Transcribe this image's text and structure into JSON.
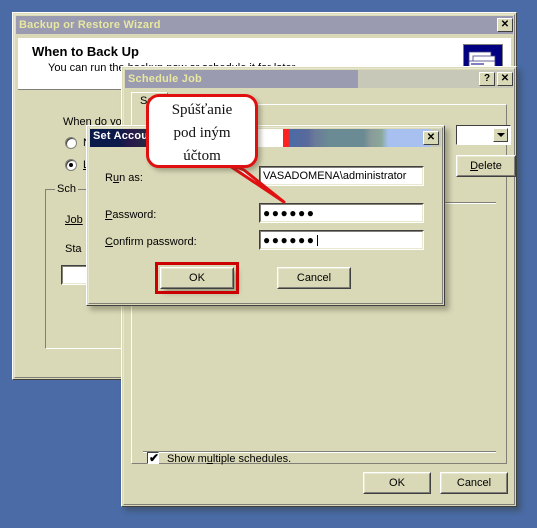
{
  "desktop": {
    "background_color": "#4a6ba5"
  },
  "wizard": {
    "title": "Backup or Restore Wizard",
    "close_label": "✕",
    "heading": "When to Back Up",
    "subheading": "You can run the backup now or schedule it for later.",
    "icon_name": "backup-wizard-icon",
    "prompt": "When do you",
    "radio_now_label": "N",
    "radio_later_label": "La",
    "group_label": "Sch",
    "field_job_label": "Job",
    "field_start_label": "Sta"
  },
  "schedule_job": {
    "title": "Schedule Job",
    "help_label": "?",
    "close_label": "✕",
    "tab_label": "Sch",
    "combo_value": "",
    "delete_button": "Delete",
    "show_multiple_label": "Show multiple schedules.",
    "ok_button": "OK",
    "cancel_button": "Cancel"
  },
  "set_account": {
    "title": "Set Account",
    "close_label": "✕",
    "run_as_label": "Run as:",
    "run_as_label_pre": "R",
    "run_as_label_accel": "u",
    "run_as_label_post": "n as:",
    "run_as_value": "VASADOMENA\\administrator",
    "password_label_accel": "P",
    "password_label_post": "assword:",
    "password_value": "●●●●●●",
    "confirm_label_accel": "C",
    "confirm_label_post": "onfirm password:",
    "confirm_value": "●●●●●●",
    "ok_button": "OK",
    "cancel_button": "Cancel",
    "highlight_color": "#cc0000"
  },
  "callout": {
    "line1": "Spúšťanie",
    "line2": "pod iným",
    "line3": "účtom",
    "border_color": "#e01010"
  }
}
